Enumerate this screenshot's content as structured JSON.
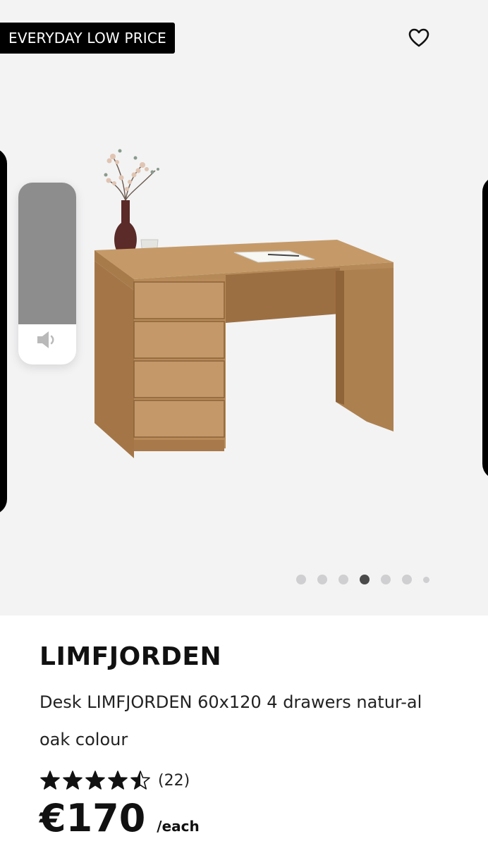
{
  "badge": {
    "label": "EVERYDAY LOW PRICE"
  },
  "favorite": {
    "icon": "heart-outline-icon"
  },
  "gallery": {
    "image": "desk-with-four-drawers-image",
    "slide_count": 7,
    "active_slide": 4
  },
  "volume_hud": {
    "icon": "speaker-icon",
    "level": 0.78
  },
  "product": {
    "name": "LIMFJORDEN",
    "description": "Desk LIMFJORDEN 60x120 4 drawers natur-al oak colour",
    "rating": {
      "stars": 4.5,
      "max": 5,
      "count_label": "(22)"
    },
    "price": "€170",
    "unit": "/each"
  },
  "colors": {
    "badge_bg": "#000000",
    "gallery_bg": "#f3f3f4",
    "wood": "#b98d5e",
    "active_dot": "#4a4a4a"
  }
}
